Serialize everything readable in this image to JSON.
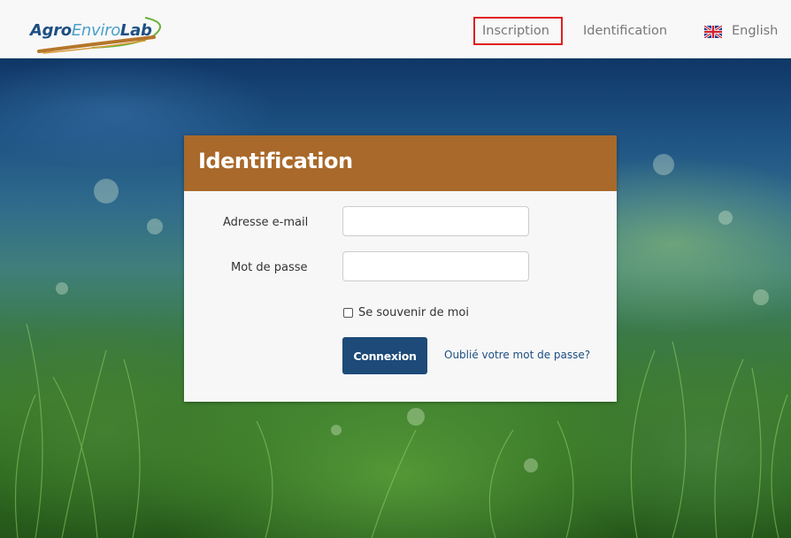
{
  "header": {
    "logo": {
      "part1": "Agro",
      "part2": "Enviro",
      "part3": "Lab"
    },
    "nav": {
      "inscription": "Inscription",
      "identification": "Identification",
      "language": "English",
      "language_icon": "uk-flag-icon"
    },
    "highlight_color": "#e02020"
  },
  "login": {
    "title": "Identification",
    "email_label": "Adresse e-mail",
    "email_value": "",
    "password_label": "Mot de passe",
    "password_value": "",
    "remember_label": "Se souvenir de moi",
    "remember_checked": false,
    "submit_label": "Connexion",
    "forgot_link": "Oublié votre mot de passe?"
  },
  "colors": {
    "card_header": "#a8692a",
    "button": "#1d4a78",
    "link": "#1d4f82",
    "nav_text": "#777777"
  }
}
